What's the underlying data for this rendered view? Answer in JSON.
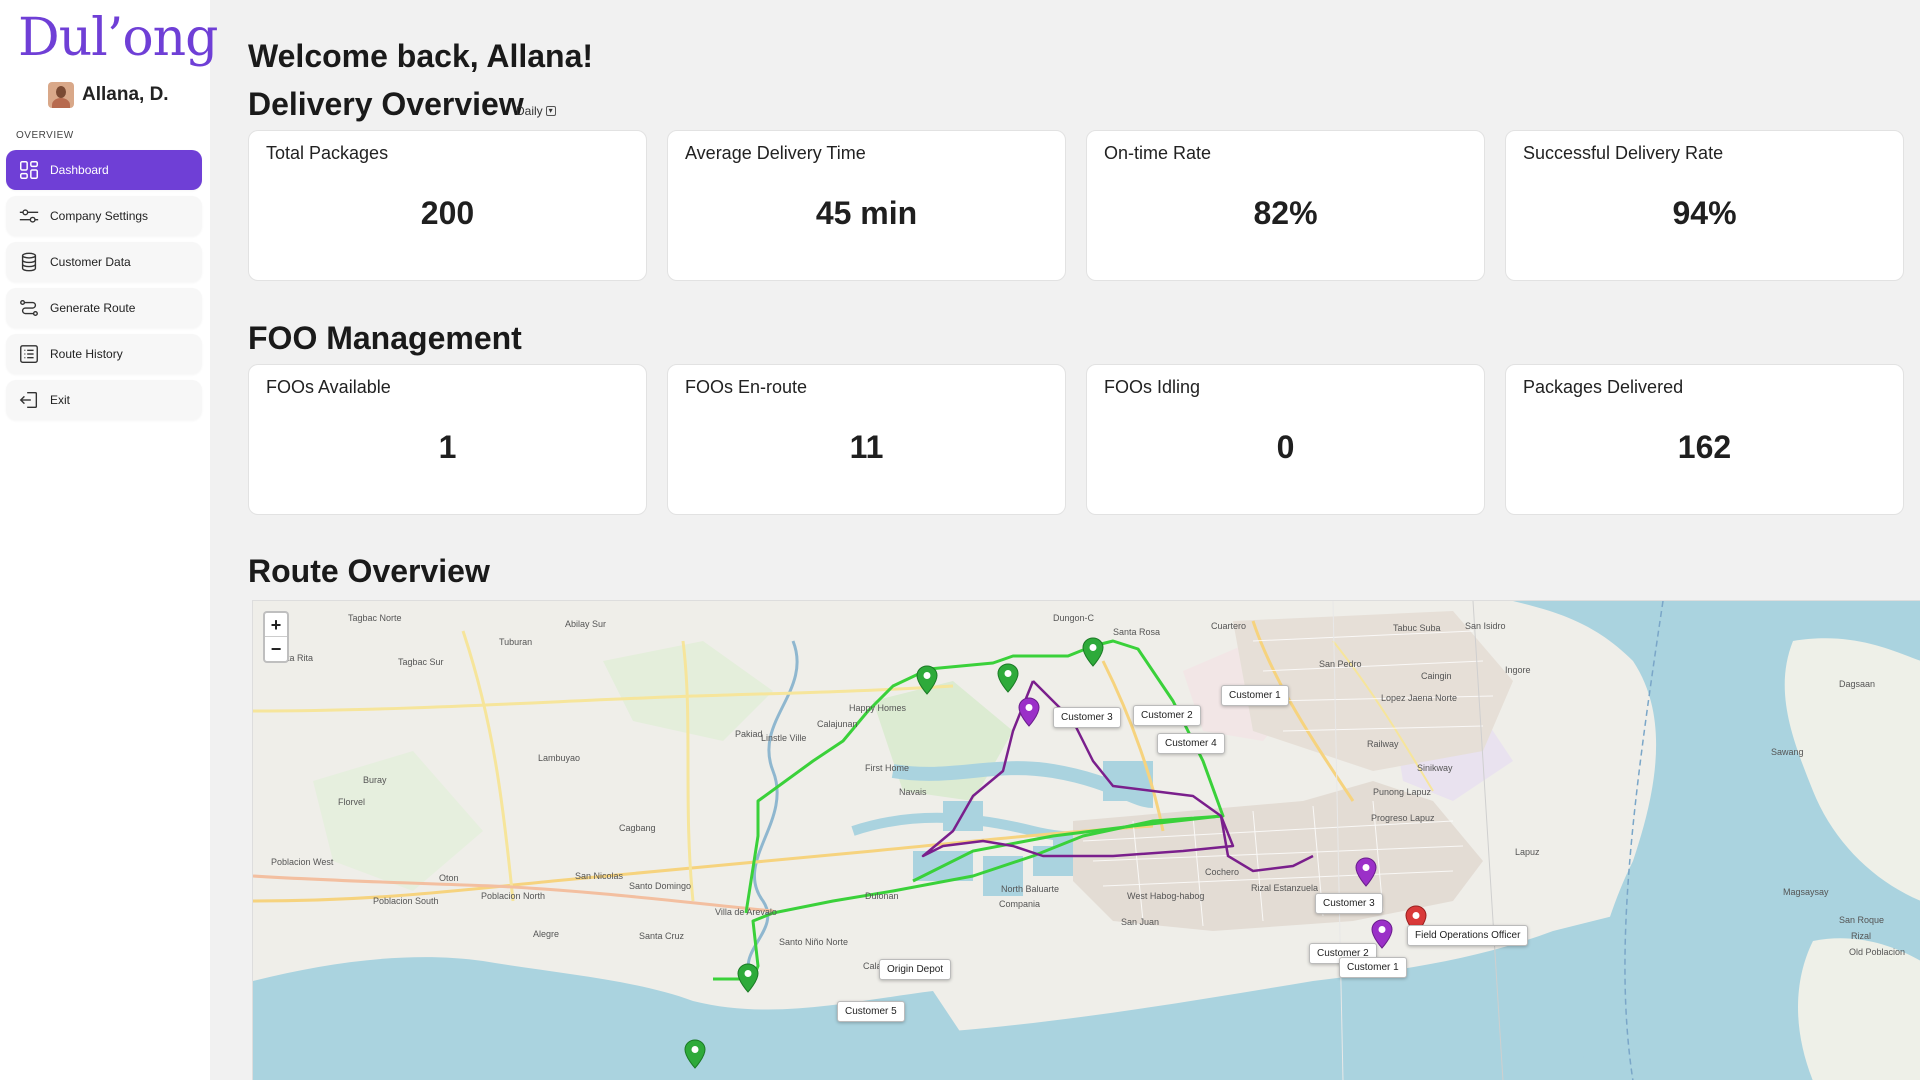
{
  "app": {
    "logo": "Dul’ong"
  },
  "user": {
    "name": "Allana, D."
  },
  "sidebar": {
    "section_label": "OVERVIEW",
    "items": [
      {
        "label": "Dashboard",
        "icon": "dashboard-icon"
      },
      {
        "label": "Company Settings",
        "icon": "sliders-icon"
      },
      {
        "label": "Customer Data",
        "icon": "database-icon"
      },
      {
        "label": "Generate Route",
        "icon": "route-icon"
      },
      {
        "label": "Route History",
        "icon": "list-icon"
      },
      {
        "label": "Exit",
        "icon": "exit-icon"
      }
    ]
  },
  "header": {
    "welcome": "Welcome back, Allana!"
  },
  "delivery_overview": {
    "title": "Delivery Overview",
    "period": "Daily",
    "cards": [
      {
        "label": "Total Packages",
        "value": "200"
      },
      {
        "label": "Average Delivery Time",
        "value": "45 min"
      },
      {
        "label": "On-time Rate",
        "value": "82%"
      },
      {
        "label": "Successful Delivery Rate",
        "value": "94%"
      }
    ]
  },
  "foo_management": {
    "title": "FOO Management",
    "cards": [
      {
        "label": "FOOs Available",
        "value": "1"
      },
      {
        "label": "FOOs En-route",
        "value": "11"
      },
      {
        "label": "FOOs Idling",
        "value": "0"
      },
      {
        "label": "Packages Delivered",
        "value": "162"
      }
    ]
  },
  "route_overview": {
    "title": "Route Overview",
    "zoom_in": "+",
    "zoom_out": "−",
    "markers": [
      {
        "label": "Customer 1",
        "color": "#2eaa3a"
      },
      {
        "label": "Customer 2",
        "color": "#2eaa3a"
      },
      {
        "label": "Customer 3",
        "color": "#2eaa3a"
      },
      {
        "label": "Customer 4",
        "color": "#9b30c8"
      },
      {
        "label": "Customer 3",
        "color": "#9b30c8"
      },
      {
        "label": "Customer 2",
        "color": "#9b30c8"
      },
      {
        "label": "Customer 1",
        "color": "#9b30c8"
      },
      {
        "label": "Field Operations Officer",
        "color": "#d93a3a"
      },
      {
        "label": "Origin Depot",
        "color": "#2eaa3a"
      },
      {
        "label": "Customer 5",
        "color": "#2eaa3a"
      }
    ],
    "places": [
      "Tagbac Norte",
      "Abilay Sur",
      "Santa Rita",
      "Tagbac Sur",
      "Tuburan",
      "Buray",
      "Florvel",
      "Lambuyao",
      "Cagbang",
      "Poblacion West",
      "Oton",
      "Poblacion North",
      "Poblacion South",
      "Alegre",
      "Santa Cruz",
      "San Nicolas",
      "Santo Domingo",
      "Villa de Arevalo",
      "Pakiad",
      "Calajunan",
      "Happy Homes",
      "First Home",
      "Navais",
      "Dulonan",
      "North Baluarte",
      "Compania",
      "Santo Niño Norte",
      "Calaparan",
      "Dungon-C",
      "Santa Rosa",
      "Cuartero",
      "Tabuc Suba",
      "San Isidro",
      "San Pedro",
      "Caingin",
      "Lopez Jaena Norte",
      "Ingore",
      "Dagsaan",
      "Railway",
      "Sinikway",
      "Punong Lapuz",
      "Progreso Lapuz",
      "Lapuz",
      "Sawang",
      "Magsaysay",
      "San Roque",
      "Rizal",
      "Old Poblacion",
      "West Habog-habog",
      "San Juan",
      "Cochero",
      "Rizal Estanzuela",
      "Linstle Ville"
    ],
    "route_colors": {
      "green": "#3ad13a",
      "purple": "#7a1f8c"
    }
  }
}
